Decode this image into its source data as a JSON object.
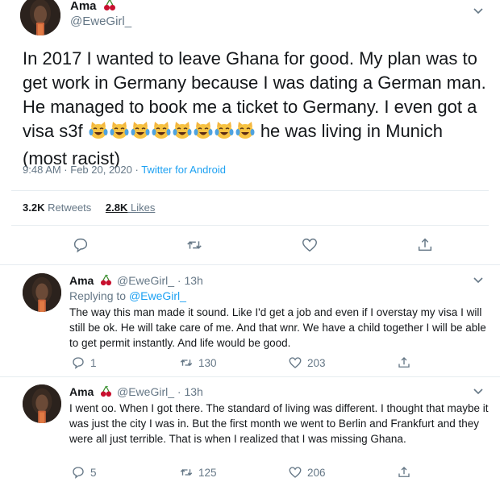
{
  "main_tweet": {
    "author_name": "Ama",
    "author_handle": "@EweGirl_",
    "text_before_emoji": "In 2017 I wanted to leave Ghana for good. My plan was to get work in Germany because I was dating a German man. He managed to book me a ticket to Germany. I even got a visa s3f ",
    "emoji_count": 8,
    "emoji_name": "joy-cat-emoji",
    "text_after_emoji": " he was living in Munich (most racist)",
    "time": "9:48 AM · Feb 20, 2020",
    "source_separator": " · ",
    "source": "Twitter for Android",
    "retweets_count": "3.2K",
    "retweets_label": "Retweets",
    "likes_count": "2.8K",
    "likes_label": "Likes"
  },
  "replies": [
    {
      "author_name": "Ama",
      "author_handle": "@EweGirl_",
      "time": "· 13h",
      "replying_prefix": "Replying to ",
      "replying_to": "@EweGirl_",
      "text": "The way this man made it sound. Like I'd get a job and even if I overstay my visa I will still be ok. He will take care of me. And that wnr. We have a child together I will be able to get permit instantly. And life would be good.",
      "reply_count": "1",
      "retweet_count": "130",
      "like_count": "203"
    },
    {
      "author_name": "Ama",
      "author_handle": "@EweGirl_",
      "time": "· 13h",
      "text": "I went oo. When I got there. The standard of living was different. I thought that maybe it was just the city I was in. But the first month we went to Berlin and Frankfurt and they were all just terrible. That is when I realized that I was missing Ghana.",
      "reply_count": "5",
      "retweet_count": "125",
      "like_count": "206"
    }
  ],
  "colors": {
    "text": "#14171a",
    "muted": "#657786",
    "link": "#1da1f2",
    "border": "#e6ecf0",
    "cherry": "#c8102e"
  }
}
